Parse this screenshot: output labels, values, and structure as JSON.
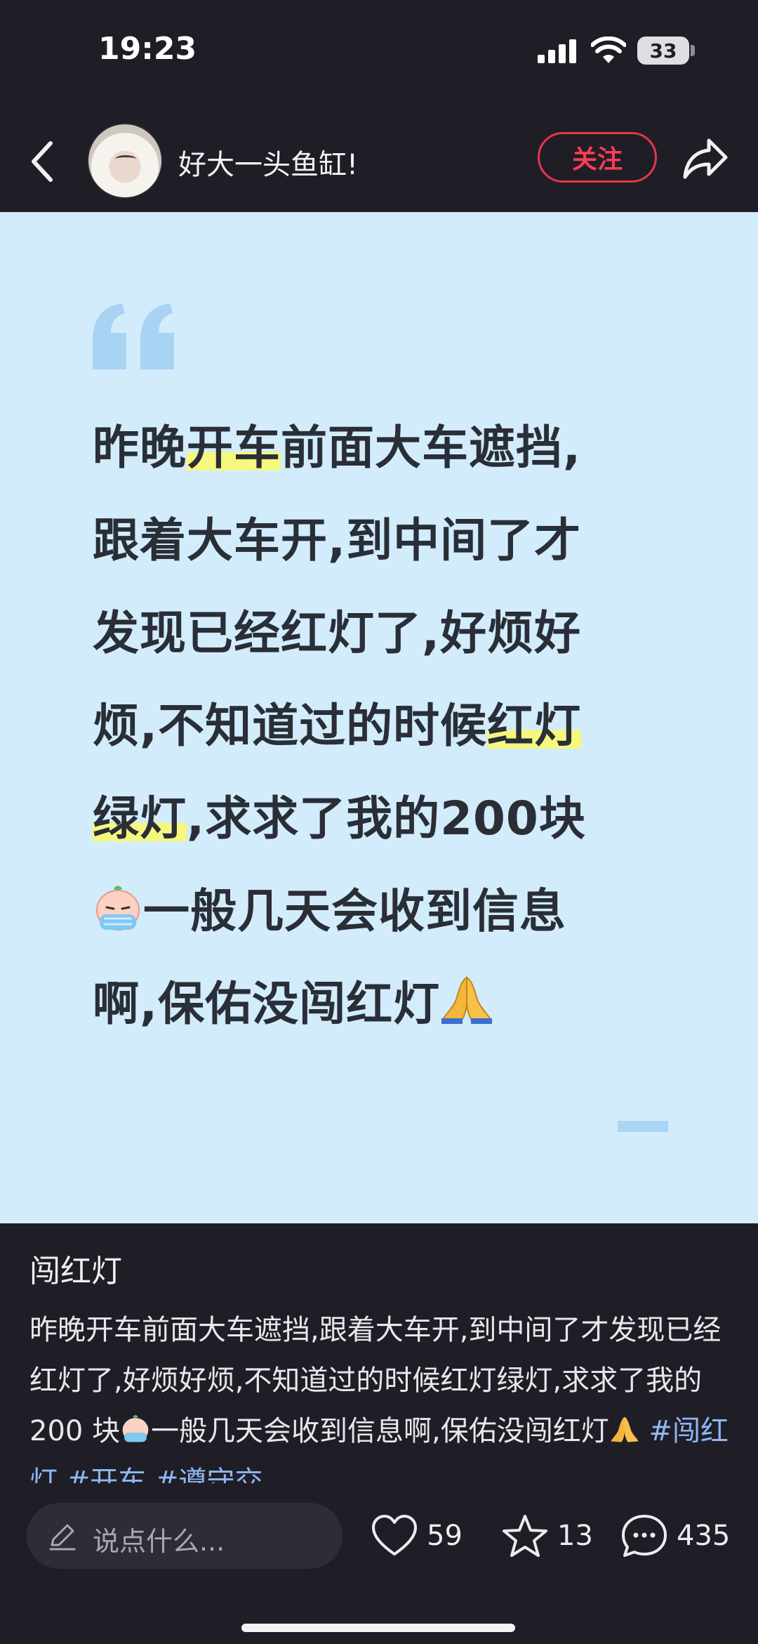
{
  "status_bar": {
    "time": "19:23",
    "battery": "33"
  },
  "header": {
    "username": "好大一头鱼缸!",
    "follow_label": "关注"
  },
  "post": {
    "segments": {
      "s1": "昨晚",
      "s2": "开车",
      "s3": "前面大车遮挡,",
      "s4": "跟着大车开,到中间了才",
      "s5": "发现已经红灯了,好烦好",
      "s6": "烦,不知道过的时候",
      "s7": "红灯",
      "s8": "绿灯",
      "s9": ",求求了我的200块",
      "s10": "一般几天会收到信息",
      "s11": "啊,保佑没闯红灯"
    }
  },
  "caption": {
    "title": "闯红灯",
    "body_1": "昨晚开车前面大车遮挡,跟着大车开,到中间了才发现已经红灯了,好烦好烦,不知道过的时候红灯绿灯,求求了我的 200 块",
    "body_2": "一般几天会收到信息啊,保佑没闯红灯",
    "tags": [
      "#闯红灯",
      "#开车",
      "#遵守交"
    ]
  },
  "bottom_bar": {
    "comment_placeholder": "说点什么...",
    "likes": "59",
    "favorites": "13",
    "comments": "435"
  },
  "colors": {
    "accent": "#ff3b55",
    "card_bg": "#d2ecfc",
    "highlight": "#f6f77f",
    "tag": "#8fb7f2"
  }
}
